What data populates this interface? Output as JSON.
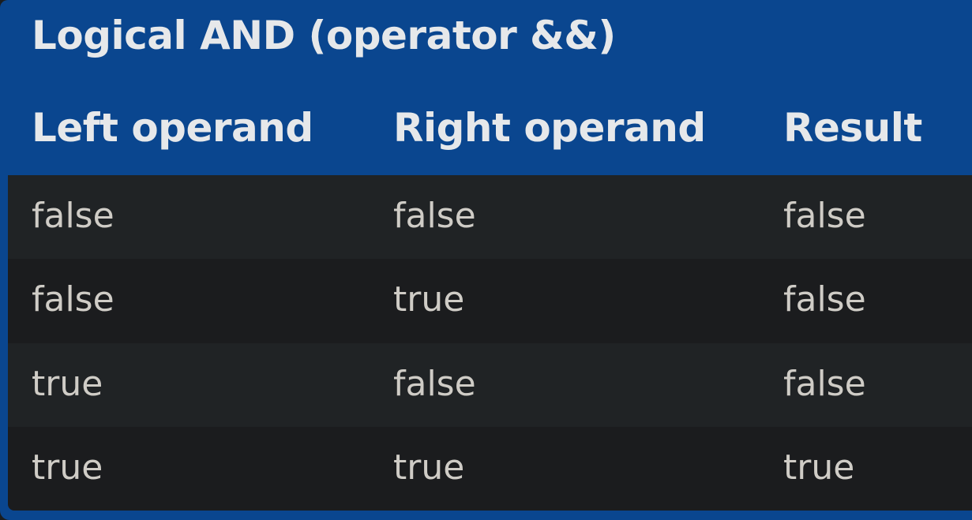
{
  "table": {
    "caption": "Logical AND (operator &&)",
    "headers": [
      "Left operand",
      "Right operand",
      "Result"
    ],
    "rows": [
      [
        "false",
        "false",
        "false"
      ],
      [
        "false",
        "true",
        "false"
      ],
      [
        "true",
        "false",
        "false"
      ],
      [
        "true",
        "true",
        "true"
      ]
    ]
  },
  "colors": {
    "header_bg": "#0a468f",
    "header_text": "#e6e8ea",
    "row_odd_bg": "#202325",
    "row_even_bg": "#1b1c1e",
    "cell_text": "#cfccc6"
  }
}
